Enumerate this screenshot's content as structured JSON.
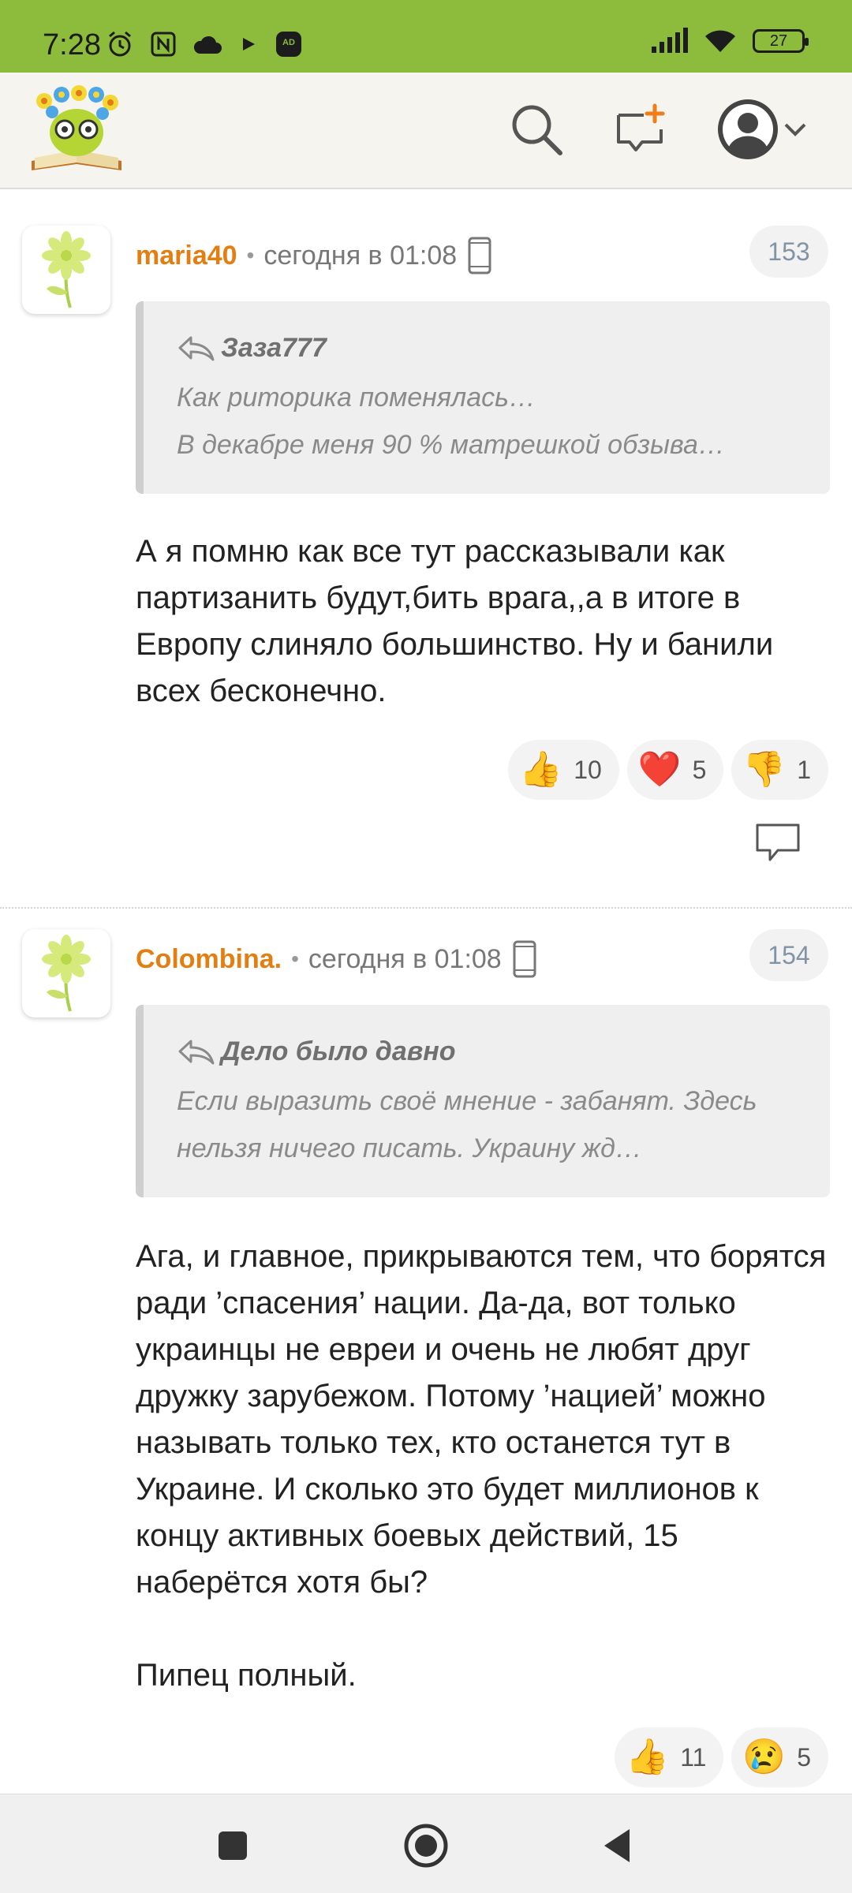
{
  "status_bar": {
    "time": "7:28",
    "battery": "27",
    "left_icons": [
      "alarm-icon",
      "nfc-icon",
      "cloud-icon",
      "play-icon",
      "adblock-icon"
    ],
    "right_icons": [
      "signal-icon",
      "wifi-icon",
      "battery-icon"
    ]
  },
  "header": {
    "logo": "reading-book-logo",
    "icons": [
      "search-icon",
      "new-message-icon",
      "user-avatar-icon",
      "chevron-down-icon"
    ]
  },
  "comments": [
    {
      "username": "maria40",
      "dot": "•",
      "time": "сегодня в 01:08",
      "number": "153",
      "quote_author": "Заза777",
      "quote_lines": [
        "Как риторика поменялась…",
        "В декабре меня 90 % матрешкой обзыва…"
      ],
      "body": [
        "А я помню как все тут рассказывали как партизанить будут,бить врага,,а в итоге в Европу слиняло большинство. Ну и банили всех бесконечно."
      ],
      "reactions": [
        {
          "emoji": "👍",
          "count": "10",
          "name": "like"
        },
        {
          "emoji": "❤️",
          "count": "5",
          "name": "heart"
        },
        {
          "emoji": "👎",
          "count": "1",
          "name": "dislike"
        }
      ]
    },
    {
      "username": "Colombina.",
      "dot": "•",
      "time": "сегодня в 01:08",
      "number": "154",
      "quote_author": "Дело было давно",
      "quote_lines": [
        "Если выразить своё мнение - забанят. Здесь",
        "нельзя ничего писать. Украину жд…"
      ],
      "body": [
        "Ага, и главное, прикрываются тем, что борятся ради ’спасения’ нации. Да-да, вот только украинцы не евреи и очень не любят друг дружку зарубежом. Потому ’нацией’ можно называть только тех, кто останется тут в Украине. И сколько это будет миллионов к концу активных боевых действий, 15 наберётся хотя бы?",
        "Пипец полный."
      ],
      "reactions": [
        {
          "emoji": "👍",
          "count": "11",
          "name": "like"
        },
        {
          "emoji": "😢",
          "count": "5",
          "name": "sad"
        }
      ]
    }
  ],
  "nav_bar": {
    "icons": [
      "recents-square-icon",
      "home-circle-icon",
      "back-triangle-icon"
    ]
  },
  "colors": {
    "status_bar": "#8dbb3c",
    "username": "#e37f12",
    "header_bg": "#f5f4ee"
  }
}
